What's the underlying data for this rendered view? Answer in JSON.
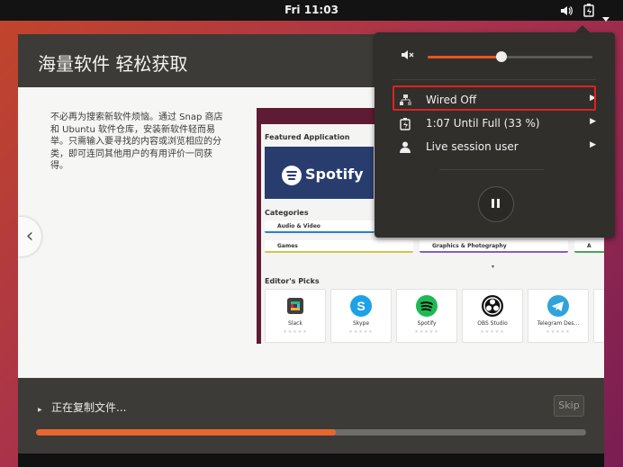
{
  "topbar": {
    "clock": "Fri 11:03",
    "icons": [
      "volume-icon",
      "battery-icon",
      "system-menu-arrow-icon"
    ]
  },
  "installer": {
    "title": "海量软件 轻松获取",
    "description": "不必再为搜索新软件烦恼。通过 Snap 商店和 Ubuntu 软件仓库，安装新软件轻而易举。只需输入要寻找的内容或浏览相应的分类，即可连同其他用户的有用评价一同获得。",
    "progress_label": "正在复制文件...",
    "progress": 0.545,
    "skip_label": "Skip"
  },
  "store": {
    "featured_heading": "Featured Application",
    "featured_app": "Spotify",
    "categories_heading": "Categories",
    "categories": [
      "Audio & Video",
      "Games",
      "Graphics & Photography",
      "A"
    ],
    "picks_heading": "Editor's Picks",
    "picks": [
      "Slack",
      "Skype",
      "Spotify",
      "OBS Studio",
      "Telegram Des..."
    ]
  },
  "menu": {
    "volume": 0.45,
    "items": [
      {
        "label": "Wired Off",
        "icon": "wired-network-icon"
      },
      {
        "label": "1:07 Until Full (33 %)",
        "icon": "battery-icon"
      },
      {
        "label": "Live session user",
        "icon": "user-icon"
      }
    ]
  },
  "colors": {
    "accent": "#e95420",
    "highlight": "#e3201e",
    "progress": "#e7662d"
  }
}
